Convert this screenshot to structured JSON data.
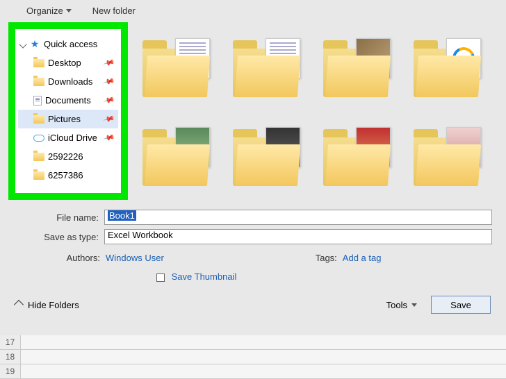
{
  "toolbar": {
    "organize": "Organize",
    "new_folder": "New folder"
  },
  "sidebar": {
    "quick_access": "Quick access",
    "items": [
      {
        "label": "Desktop",
        "pinned": true
      },
      {
        "label": "Downloads",
        "pinned": true
      },
      {
        "label": "Documents",
        "pinned": true
      },
      {
        "label": "Pictures",
        "pinned": true,
        "selected": true
      },
      {
        "label": "iCloud Drive",
        "pinned": true
      },
      {
        "label": "2592226",
        "pinned": false
      },
      {
        "label": "6257386",
        "pinned": false
      }
    ]
  },
  "form": {
    "file_name_label": "File name:",
    "file_name_value": "Book1",
    "save_as_type_label": "Save as type:",
    "save_as_type_value": "Excel Workbook",
    "authors_label": "Authors:",
    "authors_value": "Windows User",
    "tags_label": "Tags:",
    "tags_value": "Add a tag",
    "save_thumbnail": "Save Thumbnail"
  },
  "footer": {
    "hide_folders": "Hide Folders",
    "tools": "Tools",
    "save": "Save"
  },
  "sheet": {
    "rows": [
      "17",
      "18",
      "19"
    ]
  }
}
